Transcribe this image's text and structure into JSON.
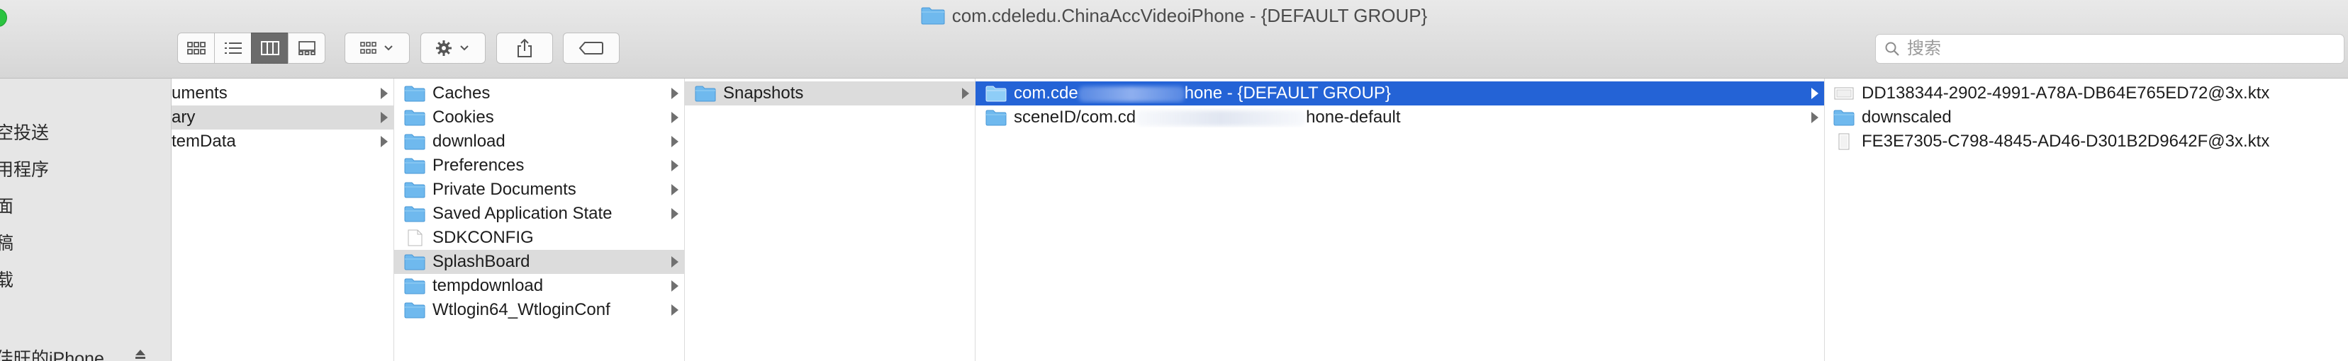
{
  "window": {
    "title": "com.cdeledu.ChinaAccVideoiPhone - {DEFAULT GROUP}"
  },
  "toolbar": {
    "view_buttons": [
      "icon-view",
      "list-view",
      "column-view",
      "gallery-view"
    ],
    "active_view": "column-view",
    "search": {
      "placeholder": "搜索",
      "value": ""
    }
  },
  "sidebar": {
    "items": [
      "空投送",
      "用程序",
      "面",
      "稿",
      "载"
    ],
    "device": "佳旺的iPhone"
  },
  "columns": [
    {
      "items": [
        {
          "label": "uments",
          "kind": "folder-partial",
          "has_children": true
        },
        {
          "label": "ary",
          "kind": "folder-partial",
          "has_children": true,
          "selected": "grey"
        },
        {
          "label": "temData",
          "kind": "folder-partial",
          "has_children": true
        }
      ]
    },
    {
      "items": [
        {
          "label": "Caches",
          "kind": "folder",
          "has_children": true
        },
        {
          "label": "Cookies",
          "kind": "folder",
          "has_children": true
        },
        {
          "label": "download",
          "kind": "folder",
          "has_children": true
        },
        {
          "label": "Preferences",
          "kind": "folder",
          "has_children": true
        },
        {
          "label": "Private Documents",
          "kind": "folder",
          "has_children": true
        },
        {
          "label": "Saved Application State",
          "kind": "folder",
          "has_children": true
        },
        {
          "label": "SDKCONFIG",
          "kind": "file",
          "has_children": false
        },
        {
          "label": "SplashBoard",
          "kind": "folder",
          "has_children": true,
          "selected": "grey"
        },
        {
          "label": "tempdownload",
          "kind": "folder",
          "has_children": true
        },
        {
          "label": "Wtlogin64_WtloginConf",
          "kind": "folder",
          "has_children": true
        }
      ]
    },
    {
      "items": [
        {
          "label": "Snapshots",
          "kind": "folder",
          "has_children": true,
          "selected": "grey"
        }
      ]
    },
    {
      "items": [
        {
          "label_pre": "com.cde",
          "label_post": "hone - {DEFAULT GROUP}",
          "kind": "folder",
          "has_children": true,
          "selected": "blue"
        },
        {
          "label_pre": "sceneID/com.cd",
          "label_post": "hone-default",
          "kind": "folder",
          "has_children": true
        }
      ]
    },
    {
      "items": [
        {
          "label": "DD138344-2902-4991-A78A-DB64E765ED72@3x.ktx",
          "kind": "ktx-file",
          "has_children": false
        },
        {
          "label": "downscaled",
          "kind": "folder",
          "has_children": false
        },
        {
          "label": "FE3E7305-C798-4845-AD46-D301B2D9642F@3x.ktx",
          "kind": "file",
          "has_children": false
        }
      ]
    }
  ],
  "colors": {
    "selection_blue": "#2463d6",
    "selection_grey": "#dcdcdc",
    "folder": "#6fb9ee"
  }
}
